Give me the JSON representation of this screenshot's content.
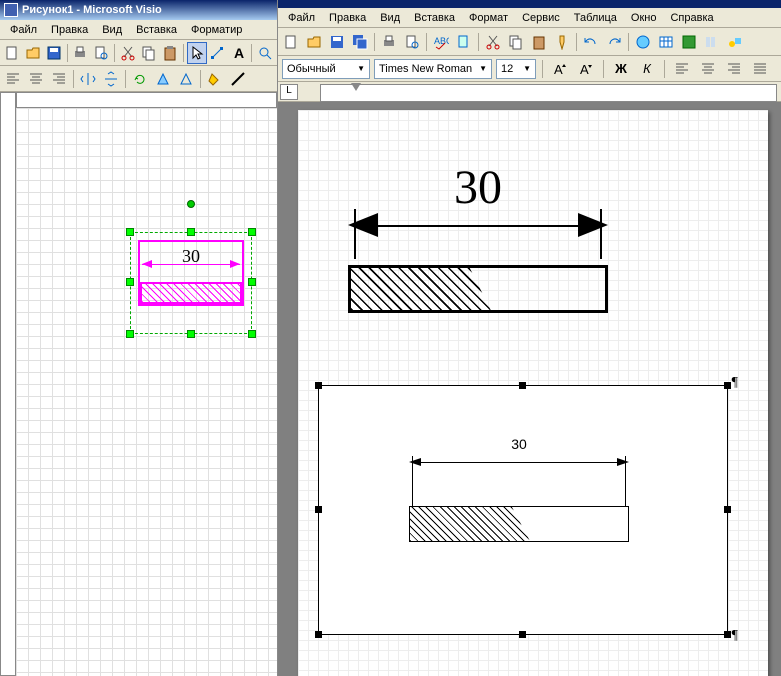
{
  "visio": {
    "title": "Рисунок1 - Microsoft Visio",
    "menu": [
      "Файл",
      "Правка",
      "Вид",
      "Вставка",
      "Форматир"
    ],
    "drawing": {
      "dimension_value": "30"
    }
  },
  "word": {
    "menu": [
      "Файл",
      "Правка",
      "Вид",
      "Вставка",
      "Формат",
      "Сервис",
      "Таблица",
      "Окно",
      "Справка"
    ],
    "style": "Обычный",
    "font": "Times New Roman",
    "size": "12",
    "big_drawing": {
      "dimension_value": "30"
    },
    "embedded_drawing": {
      "dimension_value": "30"
    }
  }
}
